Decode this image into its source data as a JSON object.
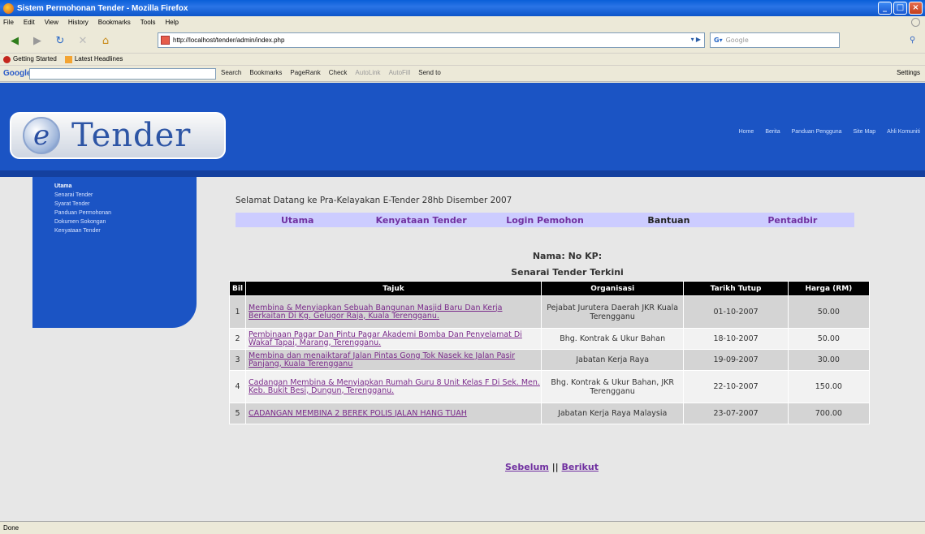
{
  "window": {
    "title": "Sistem Permohonan Tender - Mozilla Firefox"
  },
  "menu": [
    "File",
    "Edit",
    "View",
    "History",
    "Bookmarks",
    "Tools",
    "Help"
  ],
  "nav": {
    "url": "http://localhost/tender/admin/index.php",
    "search_placeholder": "Google"
  },
  "bookmarks": [
    "Getting Started",
    "Latest Headlines"
  ],
  "google_toolbar": {
    "logo": "Google",
    "items": [
      "Search",
      "Bookmarks",
      "PageRank",
      "Check",
      "AutoLink",
      "AutoFill",
      "Send to"
    ],
    "settings": "Settings"
  },
  "site": {
    "logo_text": "Tender",
    "top_links": [
      "Home",
      "Berita",
      "Panduan Pengguna",
      "Site Map",
      "Ahli Komuniti"
    ],
    "sidebar": [
      "Utama",
      "Senarai Tender",
      "Syarat Tender",
      "Panduan Permohonan",
      "Dokumen Sokongan",
      "Kenyataan Tender"
    ],
    "welcome": "Selamat Datang ke Pra-Kelayakan E-Tender 28hb Disember 2007",
    "main_nav": [
      "Utama",
      "Kenyataan Tender",
      "Login Pemohon",
      "Bantuan",
      "Pentadbir"
    ],
    "nama_line": "Nama: No KP:",
    "list_title": "Senarai Tender Terkini",
    "table": {
      "headers": [
        "Bil",
        "Tajuk",
        "Organisasi",
        "Tarikh Tutup",
        "Harga (RM)"
      ],
      "rows": [
        {
          "bil": "1",
          "tajuk": "Membina & Menyiapkan Sebuah Bangunan Masjid Baru Dan Kerja Berkaitan Di Kg. Gelugor Raja, Kuala Terengganu.",
          "organisasi": "Pejabat Jurutera Daerah JKR Kuala Terengganu",
          "tarikh": "01-10-2007",
          "harga": "50.00"
        },
        {
          "bil": "2",
          "tajuk": "Pembinaan Pagar Dan Pintu Pagar Akademi Bomba Dan Penyelamat Di Wakaf Tapai, Marang, Terengganu.",
          "organisasi": "Bhg. Kontrak & Ukur Bahan",
          "tarikh": "18-10-2007",
          "harga": "50.00"
        },
        {
          "bil": "3",
          "tajuk": "Membina dan menaiktaraf Jalan Pintas Gong Tok Nasek ke Jalan Pasir Panjang, Kuala Terengganu",
          "organisasi": "Jabatan Kerja Raya",
          "tarikh": "19-09-2007",
          "harga": "30.00"
        },
        {
          "bil": "4",
          "tajuk": "Cadangan Membina & Menyiapkan Rumah Guru 8 Unit Kelas F Di Sek. Men. Keb. Bukit Besi, Dungun, Terengganu.",
          "organisasi": "Bhg. Kontrak & Ukur Bahan, JKR Terengganu",
          "tarikh": "22-10-2007",
          "harga": "150.00"
        },
        {
          "bil": "5",
          "tajuk": "CADANGAN MEMBINA 2 BEREK POLIS JALAN HANG TUAH",
          "organisasi": "Jabatan Kerja Raya Malaysia",
          "tarikh": "23-07-2007",
          "harga": "700.00"
        }
      ]
    },
    "pager": {
      "prev": "Sebelum",
      "sep": "||",
      "next": "Berikut"
    }
  },
  "status": "Done"
}
